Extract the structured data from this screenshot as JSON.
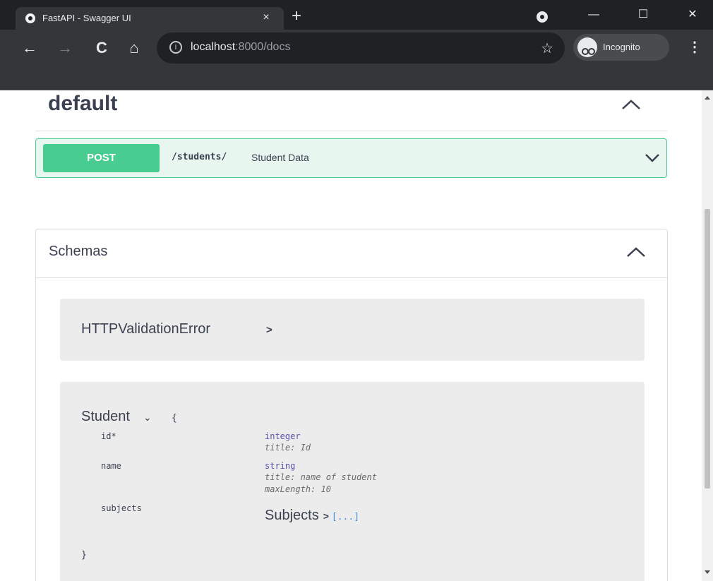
{
  "browser": {
    "tab_title": "FastAPI - Swagger UI",
    "tab_close": "×",
    "new_tab": "+",
    "url_host": "localhost",
    "url_path": ":8000/docs",
    "incognito_label": "Incognito",
    "window_min": "—",
    "window_max": "☐",
    "window_close": "✕",
    "back": "←",
    "forward": "→",
    "reload": "C",
    "home": "⌂",
    "star": "☆",
    "info": "i",
    "menu": "⋮"
  },
  "tag": {
    "title": "default"
  },
  "operation": {
    "method": "POST",
    "path": "/students/",
    "summary": "Student Data",
    "color": "#49cc90"
  },
  "schemas": {
    "title": "Schemas",
    "models": [
      {
        "name": "HTTPValidationError",
        "arrow": ">"
      },
      {
        "name": "Student",
        "toggle": "⌄",
        "open_brace": "{",
        "close_brace": "}",
        "properties": [
          {
            "name": "id*",
            "type": "integer",
            "meta": [
              "title: Id"
            ]
          },
          {
            "name": "name",
            "type": "string",
            "meta": [
              "title: name of student",
              "maxLength: 10"
            ]
          },
          {
            "name": "subjects",
            "ref": "Subjects",
            "ref_arrow": ">",
            "ref_bracket": "[...]"
          }
        ]
      }
    ]
  }
}
